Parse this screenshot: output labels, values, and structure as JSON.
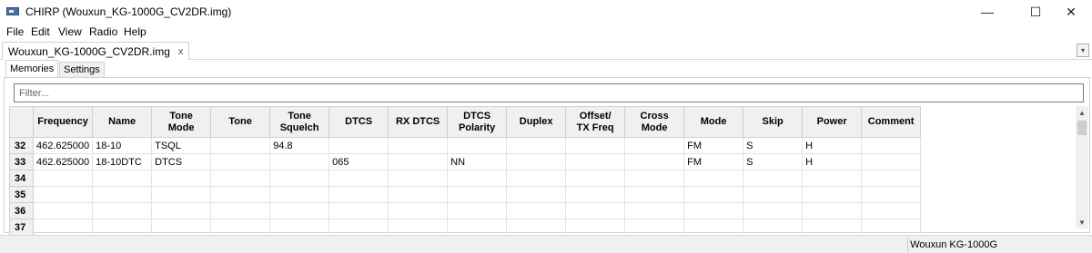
{
  "window": {
    "title": "CHIRP (Wouxun_KG-1000G_CV2DR.img)",
    "controls": {
      "minimize": "—",
      "maximize": "☐",
      "close": "✕"
    }
  },
  "menu": {
    "items": [
      "File",
      "Edit",
      "View",
      "Radio",
      "Help"
    ]
  },
  "file_tab": {
    "label": "Wouxun_KG-1000G_CV2DR.img",
    "close": "x",
    "menu_arrow": "▾"
  },
  "subtabs": {
    "memories": "Memories",
    "settings": "Settings",
    "active": "Memories"
  },
  "filter": {
    "placeholder": "Filter...",
    "value": ""
  },
  "grid": {
    "headers": [
      {
        "line1": "Frequency",
        "line2": ""
      },
      {
        "line1": "Name",
        "line2": ""
      },
      {
        "line1": "Tone",
        "line2": "Mode"
      },
      {
        "line1": "Tone",
        "line2": ""
      },
      {
        "line1": "Tone",
        "line2": "Squelch"
      },
      {
        "line1": "DTCS",
        "line2": ""
      },
      {
        "line1": "RX DTCS",
        "line2": ""
      },
      {
        "line1": "DTCS",
        "line2": "Polarity"
      },
      {
        "line1": "Duplex",
        "line2": ""
      },
      {
        "line1": "Offset/",
        "line2": "TX Freq"
      },
      {
        "line1": "Cross Mode",
        "line2": ""
      },
      {
        "line1": "Mode",
        "line2": ""
      },
      {
        "line1": "Skip",
        "line2": ""
      },
      {
        "line1": "Power",
        "line2": ""
      },
      {
        "line1": "Comment",
        "line2": ""
      }
    ],
    "rows": [
      {
        "num": "32",
        "cells": [
          "462.625000",
          "18-10",
          "TSQL",
          "",
          "94.8",
          "",
          "",
          "",
          "",
          "",
          "",
          "FM",
          "S",
          "H",
          ""
        ]
      },
      {
        "num": "33",
        "cells": [
          "462.625000",
          "18-10DTC",
          "DTCS",
          "",
          "",
          "065",
          "",
          "NN",
          "",
          "",
          "",
          "FM",
          "S",
          "H",
          ""
        ]
      },
      {
        "num": "34",
        "cells": [
          "",
          "",
          "",
          "",
          "",
          "",
          "",
          "",
          "",
          "",
          "",
          "",
          "",
          "",
          ""
        ]
      },
      {
        "num": "35",
        "cells": [
          "",
          "",
          "",
          "",
          "",
          "",
          "",
          "",
          "",
          "",
          "",
          "",
          "",
          "",
          ""
        ]
      },
      {
        "num": "36",
        "cells": [
          "",
          "",
          "",
          "",
          "",
          "",
          "",
          "",
          "",
          "",
          "",
          "",
          "",
          "",
          ""
        ]
      },
      {
        "num": "37",
        "cells": [
          "",
          "",
          "",
          "",
          "",
          "",
          "",
          "",
          "",
          "",
          "",
          "",
          "",
          "",
          ""
        ]
      }
    ]
  },
  "scrollbar": {
    "up": "▲",
    "down": "▼"
  },
  "status": {
    "radio": "Wouxun KG-1000G"
  },
  "colors": {
    "header_bg": "#f0f0f0",
    "grid_line": "#e3e3e3",
    "border": "#d0d0d0"
  }
}
